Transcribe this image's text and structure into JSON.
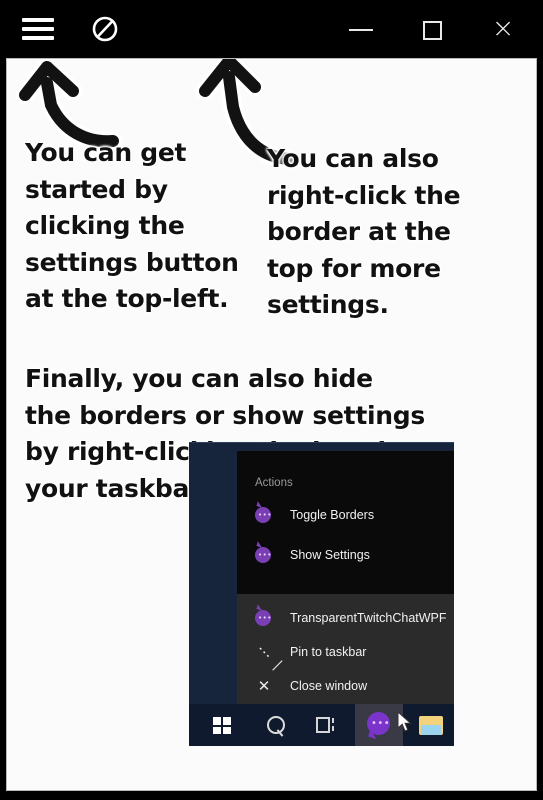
{
  "window": {
    "titlebar": {
      "menu_icon": "hamburger-menu-icon",
      "no_entry_icon": "no-entry-slash-circle-icon",
      "minimize_label": "–",
      "maximize_label": "□",
      "close_label": "×"
    },
    "background_color": "#000000",
    "content_color": "#fbfbfb"
  },
  "annotations": {
    "left_text": "You can get started by clicking the settings button at the top-left.",
    "right_text": "You can also right-click the border at the top for more settings.",
    "bottom_text": "Finally, you can also hide the borders or show settings by right-clicking the icon in your taskbar.",
    "arrow_left_name": "curved-arrow-up-left",
    "arrow_right_name": "curved-arrow-up-left"
  },
  "embedded_screenshot": {
    "desktop_color": "#16243c",
    "jumplist": {
      "actions_header": "Actions",
      "actions_bg": "#0a0a0a",
      "app_bg": "#2b2b2b",
      "action_items": [
        {
          "label": "Toggle Borders",
          "icon": "chat-bubble-icon"
        },
        {
          "label": "Show Settings",
          "icon": "chat-bubble-icon"
        }
      ],
      "app_items": [
        {
          "label": "TransparentTwitchChatWPF",
          "icon": "chat-bubble-icon"
        },
        {
          "label": "Pin to taskbar",
          "icon": "pin-icon"
        },
        {
          "label": "Close window",
          "icon": "close-icon"
        }
      ]
    },
    "taskbar": {
      "background": "#101a2e",
      "highlight_color": "#3a3a46",
      "accent_color": "#7b34c9",
      "items": [
        {
          "name": "start-button",
          "icon": "windows-logo-icon"
        },
        {
          "name": "search-button",
          "icon": "search-magnifier-icon"
        },
        {
          "name": "task-view-button",
          "icon": "task-view-icon"
        },
        {
          "name": "transparent-twitch-chat-taskbar-button",
          "icon": "chat-bubble-icon"
        },
        {
          "name": "file-explorer-taskbar-button",
          "icon": "folder-icon"
        }
      ],
      "cursor": "mouse-pointer-icon"
    }
  }
}
